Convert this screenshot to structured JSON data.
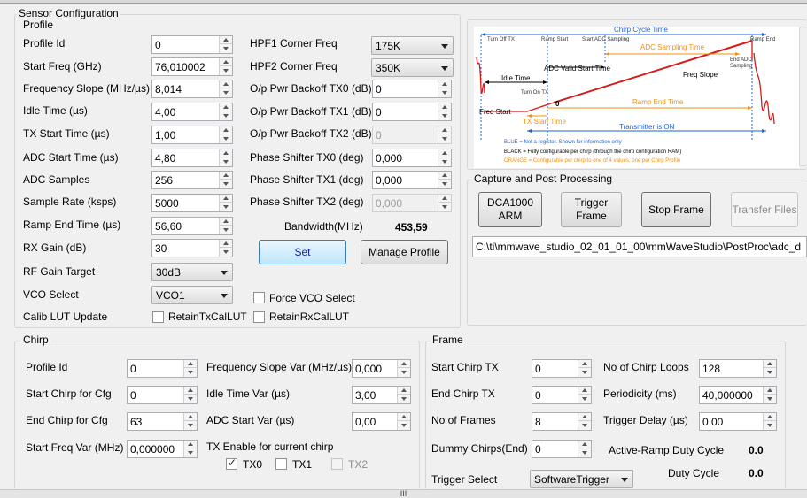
{
  "window": {
    "title": "Sensor Configuration",
    "status_grip": "III"
  },
  "profile": {
    "title": "Profile",
    "profile_id": {
      "label": "Profile Id",
      "value": "0"
    },
    "start_freq": {
      "label": "Start Freq (GHz)",
      "value": "76,010002"
    },
    "freq_slope": {
      "label": "Frequency Slope (MHz/µs)",
      "value": "8,014"
    },
    "idle_time": {
      "label": "Idle Time (µs)",
      "value": "4,00"
    },
    "tx_start_time": {
      "label": "TX Start Time (µs)",
      "value": "1,00"
    },
    "adc_start_time": {
      "label": "ADC Start Time (µs)",
      "value": "4,80"
    },
    "adc_samples": {
      "label": "ADC Samples",
      "value": "256"
    },
    "sample_rate": {
      "label": "Sample Rate (ksps)",
      "value": "5000"
    },
    "ramp_end_time": {
      "label": "Ramp End Time (µs)",
      "value": "56,60"
    },
    "rx_gain": {
      "label": "RX Gain (dB)",
      "value": "30"
    },
    "rf_gain_target": {
      "label": "RF Gain Target",
      "value": "30dB"
    },
    "vco_select": {
      "label": "VCO Select",
      "value": "VCO1"
    },
    "calib_lut": {
      "label": "Calib LUT Update",
      "retain_tx_label": "RetainTxCalLUT",
      "retain_rx_label": "RetainRxCalLUT",
      "retain_tx_checked": false,
      "retain_rx_checked": false
    },
    "hpf1": {
      "label": "HPF1 Corner Freq",
      "value": "175K"
    },
    "hpf2": {
      "label": "HPF2 Corner Freq",
      "value": "350K"
    },
    "pwr_tx0": {
      "label": "O/p Pwr Backoff TX0 (dB)",
      "value": "0"
    },
    "pwr_tx1": {
      "label": "O/p Pwr Backoff TX1 (dB)",
      "value": "0"
    },
    "pwr_tx2": {
      "label": "O/p Pwr Backoff TX2 (dB)",
      "value": "0"
    },
    "phase_tx0": {
      "label": "Phase Shifter TX0 (deg)",
      "value": "0,000"
    },
    "phase_tx1": {
      "label": "Phase Shifter TX1 (deg)",
      "value": "0,000"
    },
    "phase_tx2": {
      "label": "Phase Shifter TX2 (deg)",
      "value": "0,000"
    },
    "bandwidth": {
      "label": "Bandwidth(MHz)",
      "value": "453,59"
    },
    "force_vco": {
      "label": "Force VCO Select",
      "checked": false
    },
    "set_label": "Set",
    "manage_label": "Manage Profile"
  },
  "diagram": {
    "chirp_cycle_time": "Chirp Cycle Time",
    "turn_off_tx": "Turn Off TX",
    "ramp_start": "Ramp Start",
    "start_adc_sampling": "Start ADC Sampling",
    "ramp_end": "Ramp End",
    "adc_sampling_time": "ADC Sampling Time",
    "end_adc_sampling": "End ADC Sampling",
    "adc_valid_start_time": "ADC Valid Start Time",
    "idle_time": "Idle Time",
    "freq_slope": "Freq Slope",
    "turn_on_tx": "Turn On TX",
    "zero": "0",
    "freq_start": "Freq Start",
    "ramp_end_time": "Ramp End Time",
    "tx_start_time": "TX Start Time",
    "transmitter_on": "Transmitter is ON",
    "legend_blue": "BLUE = Not a register. Shown for information only",
    "legend_black": "BLACK = Fully configurable per chirp (through the chirp configuration RAM)",
    "legend_orange": "ORANGE = Configurable per chirp to one of 4 values, one per Chirp Profile",
    "colors": {
      "blue": "#1f62d6",
      "orange": "#f29111",
      "red": "#d61a1a"
    }
  },
  "capture": {
    "title": "Capture and Post Processing",
    "dca_label": "DCA1000 ARM",
    "trigger_label": "Trigger Frame",
    "stop_label": "Stop Frame",
    "transfer_label": "Transfer Files",
    "path": "C:\\ti\\mmwave_studio_02_01_01_00\\mmWaveStudio\\PostProc\\adc_d"
  },
  "chirp": {
    "title": "Chirp",
    "profile_id": {
      "label": "Profile Id",
      "value": "0"
    },
    "start_chirp": {
      "label": "Start Chirp for Cfg",
      "value": "0"
    },
    "end_chirp": {
      "label": "End Chirp for Cfg",
      "value": "63"
    },
    "start_freq_var": {
      "label": "Start Freq Var (MHz)",
      "value": "0,000000"
    },
    "freq_slope_var": {
      "label": "Frequency Slope Var (MHz/µs)",
      "value": "0,000"
    },
    "idle_time_var": {
      "label": "Idle Time Var (µs)",
      "value": "3,00"
    },
    "adc_start_var": {
      "label": "ADC Start Var (µs)",
      "value": "0,00"
    },
    "tx_enable": {
      "label": "TX Enable for current chirp",
      "tx0": "TX0",
      "tx1": "TX1",
      "tx2": "TX2",
      "tx0_checked": true,
      "tx1_checked": false,
      "tx2_checked": false
    }
  },
  "frame": {
    "title": "Frame",
    "start_chirp_tx": {
      "label": "Start Chirp TX",
      "value": "0"
    },
    "end_chirp_tx": {
      "label": "End Chirp TX",
      "value": "0"
    },
    "no_of_frames": {
      "label": "No of Frames",
      "value": "8"
    },
    "dummy_chirps": {
      "label": "Dummy Chirps(End)",
      "value": "0"
    },
    "trigger_select": {
      "label": "Trigger Select",
      "value": "SoftwareTrigger"
    },
    "no_chirp_loops": {
      "label": "No of Chirp Loops",
      "value": "128"
    },
    "periodicity": {
      "label": "Periodicity (ms)",
      "value": "40,000000"
    },
    "trigger_delay": {
      "label": "Trigger Delay (µs)",
      "value": "0,00"
    },
    "active_ramp_duty": {
      "label": "Active-Ramp Duty Cycle",
      "value": "0.0"
    },
    "duty_cycle": {
      "label": "Duty Cycle",
      "value": "0.0"
    }
  }
}
